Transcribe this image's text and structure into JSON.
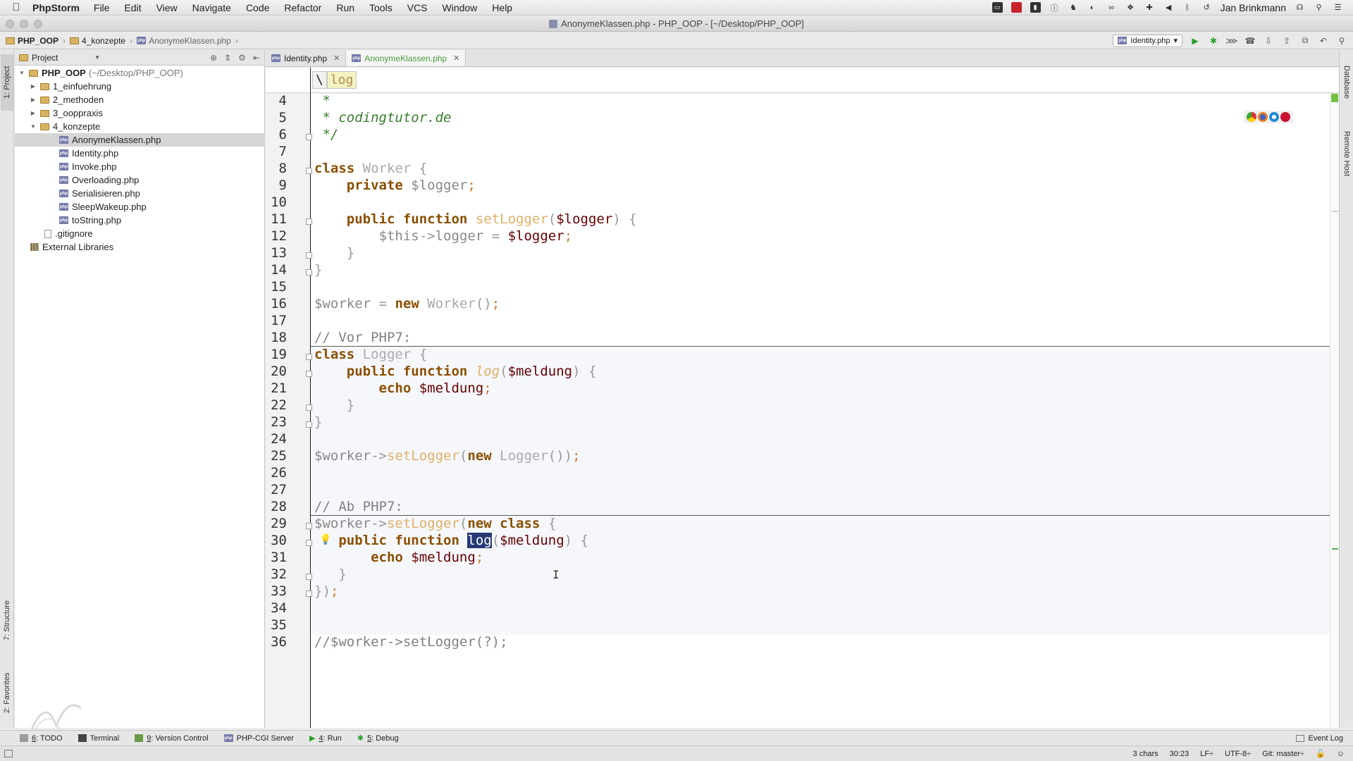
{
  "menubar": {
    "app": "PhpStorm",
    "menus": [
      "File",
      "Edit",
      "View",
      "Navigate",
      "Code",
      "Refactor",
      "Run",
      "Tools",
      "VCS",
      "Window",
      "Help"
    ],
    "user": "Jan Brinkmann"
  },
  "window": {
    "title": "AnonymeKlassen.php - PHP_OOP - [~/Desktop/PHP_OOP]"
  },
  "navbar": {
    "crumbs": [
      "PHP_OOP",
      "4_konzepte",
      "AnonymeKlassen.php"
    ],
    "run_config": "Identity.php"
  },
  "project": {
    "header": "Project",
    "root_name": "PHP_OOP",
    "root_path": "(~/Desktop/PHP_OOP)",
    "items": [
      {
        "label": "1_einfuehrung"
      },
      {
        "label": "2_methoden"
      },
      {
        "label": "3_ooppraxis"
      },
      {
        "label": "4_konzepte"
      },
      {
        "label": "AnonymeKlassen.php"
      },
      {
        "label": "Identity.php"
      },
      {
        "label": "Invoke.php"
      },
      {
        "label": "Overloading.php"
      },
      {
        "label": "Serialisieren.php"
      },
      {
        "label": "SleepWakeup.php"
      },
      {
        "label": "toString.php"
      },
      {
        "label": ".gitignore"
      },
      {
        "label": "External Libraries"
      }
    ]
  },
  "tabs": [
    {
      "label": "Identity.php"
    },
    {
      "label": "AnonymeKlassen.php"
    }
  ],
  "editor": {
    "ns_slash": "\\",
    "ns_function": "log",
    "line_numbers": [
      "4",
      "5",
      "6",
      "7",
      "8",
      "9",
      "10",
      "11",
      "12",
      "13",
      "14",
      "15",
      "16",
      "17",
      "18",
      "19",
      "20",
      "21",
      "22",
      "23",
      "24",
      "25",
      "26",
      "27",
      "28",
      "29",
      "30",
      "31",
      "32",
      "33",
      "34",
      "35",
      "36"
    ],
    "tokens": {
      "star": "*",
      "site": "* codingtutor.de",
      "close": "*/",
      "class": "class",
      "Worker": "Worker",
      "private": "private",
      "logger_var": "$logger",
      "public": "public",
      "function": "function",
      "setLogger": "setLogger",
      "this": "$this",
      "arrow": "->",
      "logger_prop": "logger",
      "eq": "=",
      "new": "new",
      "worker_var": "$worker",
      "comment_vor": "// Vor PHP7:",
      "Logger": "Logger",
      "log": "log",
      "meldung": "$meldung",
      "echo": "echo",
      "comment_ab": "// Ab PHP7:",
      "comment_last": "//$worker->setLogger(?);"
    }
  },
  "toolwindows": {
    "left_vertical": [
      "1: Project",
      "7: Structure",
      "2: Favorites"
    ],
    "right_vertical": [
      "Database",
      "Remote Host"
    ],
    "bottom": [
      {
        "num": "6",
        "label": ": TODO"
      },
      {
        "num": "",
        "label": "Terminal"
      },
      {
        "num": "9",
        "label": ": Version Control"
      },
      {
        "num": "",
        "label": "PHP-CGI Server"
      },
      {
        "num": "4",
        "label": ": Run"
      },
      {
        "num": "5",
        "label": ": Debug"
      }
    ],
    "event_log": "Event Log"
  },
  "status": {
    "chars": "3 chars",
    "position": "30:23",
    "line_sep": "LF÷",
    "encoding": "UTF-8÷",
    "git": "Git: master÷"
  }
}
